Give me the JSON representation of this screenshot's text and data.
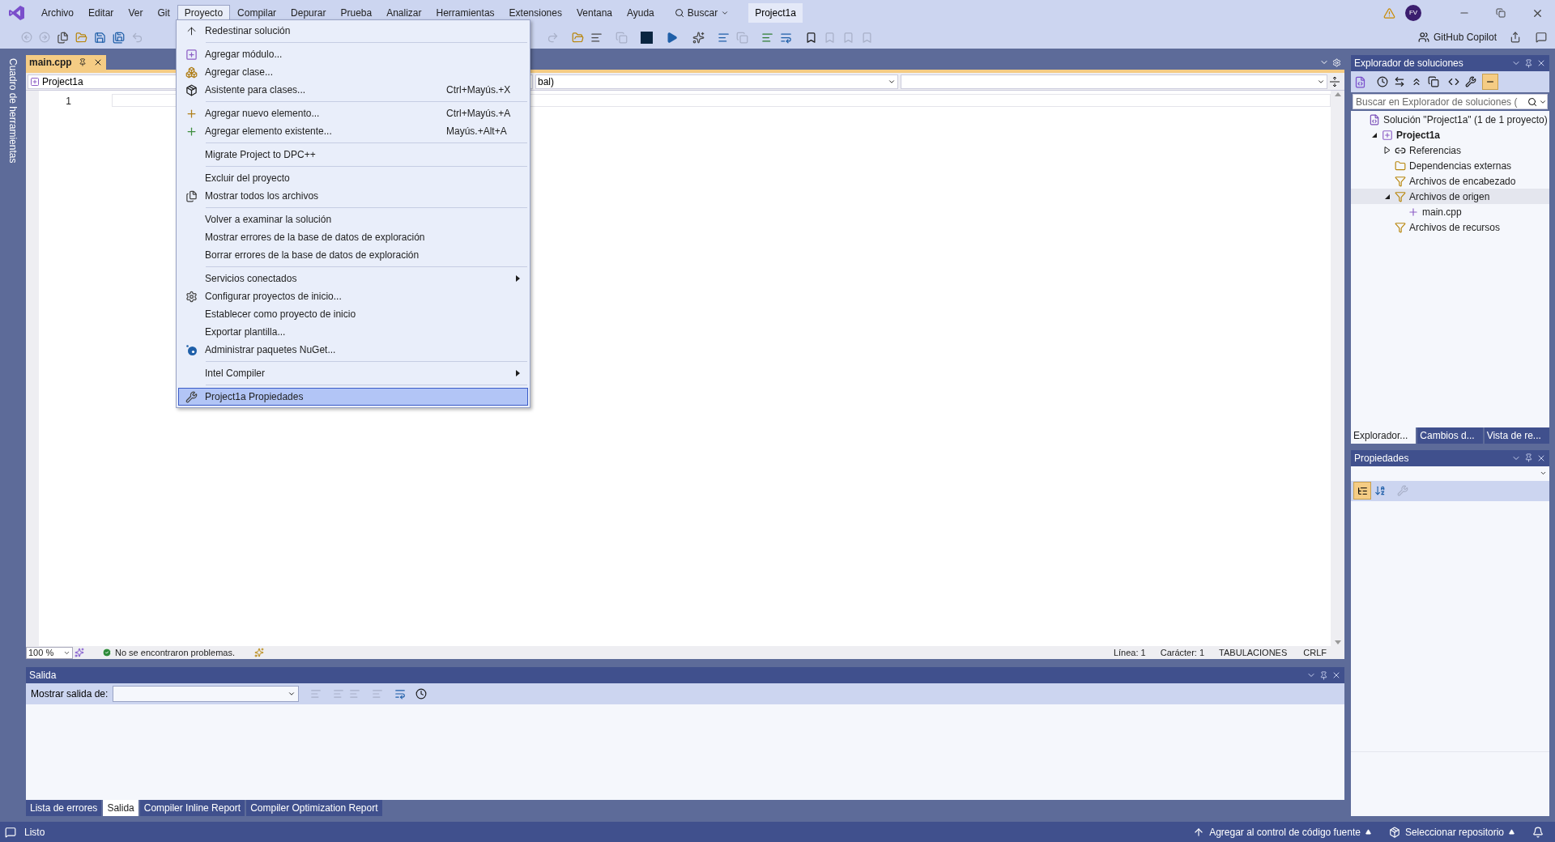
{
  "menu_bar": {
    "items": [
      {
        "label": "Archivo",
        "selected": false
      },
      {
        "label": "Editar",
        "selected": false
      },
      {
        "label": "Ver",
        "selected": false
      },
      {
        "label": "Git",
        "selected": false
      },
      {
        "label": "Proyecto",
        "selected": true
      },
      {
        "label": "Compilar",
        "selected": false
      },
      {
        "label": "Depurar",
        "selected": false
      },
      {
        "label": "Prueba",
        "selected": false
      },
      {
        "label": "Analizar",
        "selected": false
      },
      {
        "label": "Herramientas",
        "selected": false
      },
      {
        "label": "Extensiones",
        "selected": false
      },
      {
        "label": "Ventana",
        "selected": false
      },
      {
        "label": "Ayuda",
        "selected": false
      }
    ],
    "search": "Buscar",
    "title": "Project1a",
    "account": "FV"
  },
  "toolbar": {
    "copilot": "GitHub Copilot"
  },
  "toolbox": "Cuadro de herramientas",
  "editor": {
    "tabs": [
      {
        "title": "main.cpp",
        "selected": true
      }
    ],
    "project": "Project1a",
    "scope": "bal)",
    "line_numbers": [
      "1"
    ],
    "zoom": "100 %",
    "issues": "No se encontraron problemas.",
    "line": "Línea: 1",
    "column": "Carácter: 1",
    "indent": "TABULACIONES",
    "eol": "CRLF"
  },
  "project_menu": {
    "groups": [
      [
        {
          "label": "Redestinar solución",
          "selected": false
        }
      ],
      [
        {
          "label": "Agregar módulo...",
          "selected": false
        },
        {
          "label": "Agregar clase...",
          "selected": false
        },
        {
          "label": "Asistente para clases...",
          "shortcut": "Ctrl+Mayús.+X",
          "selected": false
        }
      ],
      [
        {
          "label": "Agregar nuevo elemento...",
          "shortcut": "Ctrl+Mayús.+A",
          "selected": false
        },
        {
          "label": "Agregar elemento existente...",
          "shortcut": "Mayús.+Alt+A",
          "selected": false
        }
      ],
      [
        {
          "label": "Migrate Project to DPC++",
          "selected": false
        }
      ],
      [
        {
          "label": "Excluir del proyecto",
          "selected": false
        },
        {
          "label": "Mostrar todos los archivos",
          "selected": false
        }
      ],
      [
        {
          "label": "Volver a examinar la solución",
          "selected": false
        },
        {
          "label": "Mostrar errores de la base de datos de exploración",
          "selected": false
        },
        {
          "label": "Borrar errores de la base de datos de exploración",
          "selected": false
        }
      ],
      [
        {
          "label": "Servicios conectados",
          "submenu": true,
          "selected": false
        },
        {
          "label": "Configurar proyectos de inicio...",
          "selected": false
        },
        {
          "label": "Establecer como proyecto de inicio",
          "selected": false
        },
        {
          "label": "Exportar plantilla...",
          "selected": false
        },
        {
          "label": "Administrar paquetes NuGet...",
          "selected": false
        }
      ],
      [
        {
          "label": "Intel Compiler",
          "submenu": true,
          "selected": false
        }
      ],
      [
        {
          "label": "Project1a Propiedades",
          "selected": true
        }
      ]
    ]
  },
  "output": {
    "title": "Salida",
    "source_label": "Mostrar salida de:",
    "tabs": [
      {
        "label": "Lista de errores",
        "selected": false
      },
      {
        "label": "Salida",
        "selected": true
      },
      {
        "label": "Compiler Inline Report",
        "selected": false
      },
      {
        "label": "Compiler Optimization Report",
        "selected": false
      }
    ]
  },
  "solution_explorer": {
    "title": "Explorador de soluciones",
    "placeholder": "Buscar en Explorador de soluciones (",
    "tree": [
      {
        "label": "Solución \"Project1a\"  (1 de 1 proyecto)",
        "kind": "solution",
        "selected": false,
        "children": [
          {
            "label": "Project1a",
            "kind": "project",
            "expanded": true,
            "selected": false,
            "children": [
              {
                "label": "Referencias",
                "kind": "references",
                "expanded": false,
                "selected": false
              },
              {
                "label": "Dependencias externas",
                "kind": "folder",
                "selected": false
              },
              {
                "label": "Archivos de encabezado",
                "kind": "filter",
                "selected": false
              },
              {
                "label": "Archivos de origen",
                "kind": "filter",
                "expanded": true,
                "selected": true,
                "children": [
                  {
                    "label": "main.cpp",
                    "kind": "file",
                    "selected": false
                  }
                ]
              },
              {
                "label": "Archivos de recursos",
                "kind": "filter",
                "selected": false
              }
            ]
          }
        ]
      }
    ],
    "tabs": [
      {
        "label": "Explorador...",
        "selected": true
      },
      {
        "label": "Cambios d...",
        "selected": false
      },
      {
        "label": "Vista de re...",
        "selected": false
      }
    ]
  },
  "properties": {
    "title": "Propiedades"
  },
  "status_bar": {
    "state": "Listo",
    "source_control": "Agregar al control de código fuente",
    "repository": "Seleccionar repositorio"
  }
}
